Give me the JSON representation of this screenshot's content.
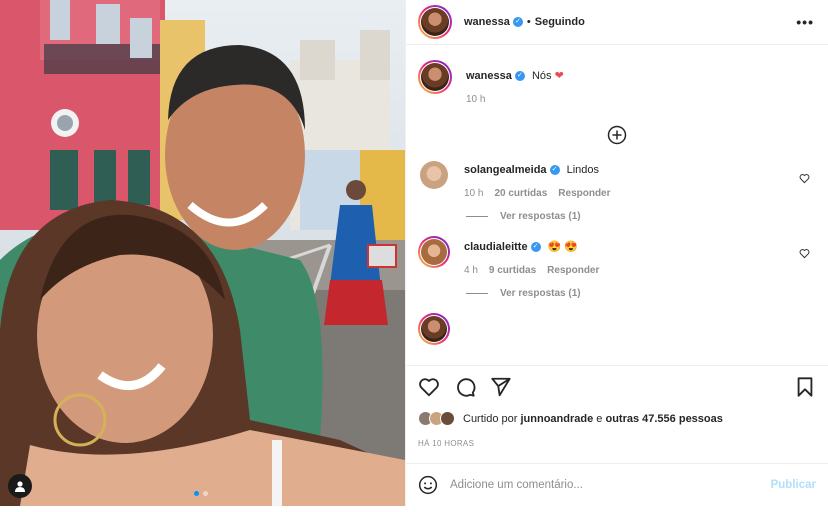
{
  "post": {
    "author": "wanessa",
    "follow_status": "Seguindo",
    "separator": "•",
    "more": "•••",
    "caption": "Nós",
    "caption_time": "10 h",
    "photo_index": 1,
    "photo_count": 2
  },
  "comments": [
    {
      "username": "solangealmeida",
      "verified": true,
      "text": "Lindos",
      "time": "10 h",
      "likes": "20 curtidas",
      "reply_label": "Responder",
      "view_replies": "Ver respostas (1)"
    },
    {
      "username": "claudialeitte",
      "verified": true,
      "text": "😍 😍",
      "time": "4 h",
      "likes": "9 curtidas",
      "reply_label": "Responder",
      "view_replies": "Ver respostas (1)"
    }
  ],
  "likes": {
    "prefix": "Curtido por",
    "user": "junnoandrade",
    "middle": "e",
    "others": "outras 47.556 pessoas"
  },
  "timestamp": "HÁ 10 HORAS",
  "add_comment": {
    "placeholder": "Adicione um comentário...",
    "publish_label": "Publicar"
  },
  "colors": {
    "heart": "#ed4956",
    "verified": "#3897f0",
    "publish_disabled": "#b2dffc",
    "dot_active": "#0095f6"
  }
}
